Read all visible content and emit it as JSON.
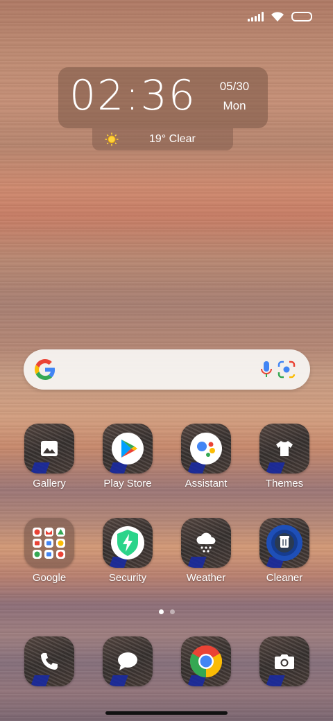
{
  "status_bar": {
    "signal_icon": "signal-icon",
    "wifi_icon": "wifi-icon",
    "battery_icon": "battery-icon"
  },
  "clock_widget": {
    "time": "02:36",
    "date": "05/30",
    "day": "Mon",
    "weather_icon": "sun-icon",
    "weather": "19° Clear"
  },
  "search_bar": {
    "google_icon": "google-g-icon",
    "mic_icon": "mic-icon",
    "lens_icon": "lens-icon"
  },
  "apps_row1": [
    {
      "label": "Gallery",
      "icon": "gallery-icon"
    },
    {
      "label": "Play Store",
      "icon": "play-store-icon"
    },
    {
      "label": "Assistant",
      "icon": "assistant-icon"
    },
    {
      "label": "Themes",
      "icon": "tshirt-icon"
    }
  ],
  "apps_row2": [
    {
      "label": "Google",
      "icon": "folder-icon"
    },
    {
      "label": "Security",
      "icon": "security-icon"
    },
    {
      "label": "Weather",
      "icon": "cloud-snow-icon"
    },
    {
      "label": "Cleaner",
      "icon": "cleaner-icon"
    }
  ],
  "dock": [
    {
      "name": "phone",
      "icon": "phone-icon"
    },
    {
      "name": "messages",
      "icon": "message-icon"
    },
    {
      "name": "chrome",
      "icon": "chrome-icon"
    },
    {
      "name": "camera",
      "icon": "camera-icon"
    }
  ],
  "page_indicator": {
    "pages": 2,
    "current": 1
  },
  "colors": {
    "google_blue": "#4285F4",
    "google_red": "#EA4335",
    "google_yellow": "#FBBC05",
    "google_green": "#34A853",
    "security_green": "#2bd48a",
    "cleaner_blue": "#1e4fb8"
  }
}
